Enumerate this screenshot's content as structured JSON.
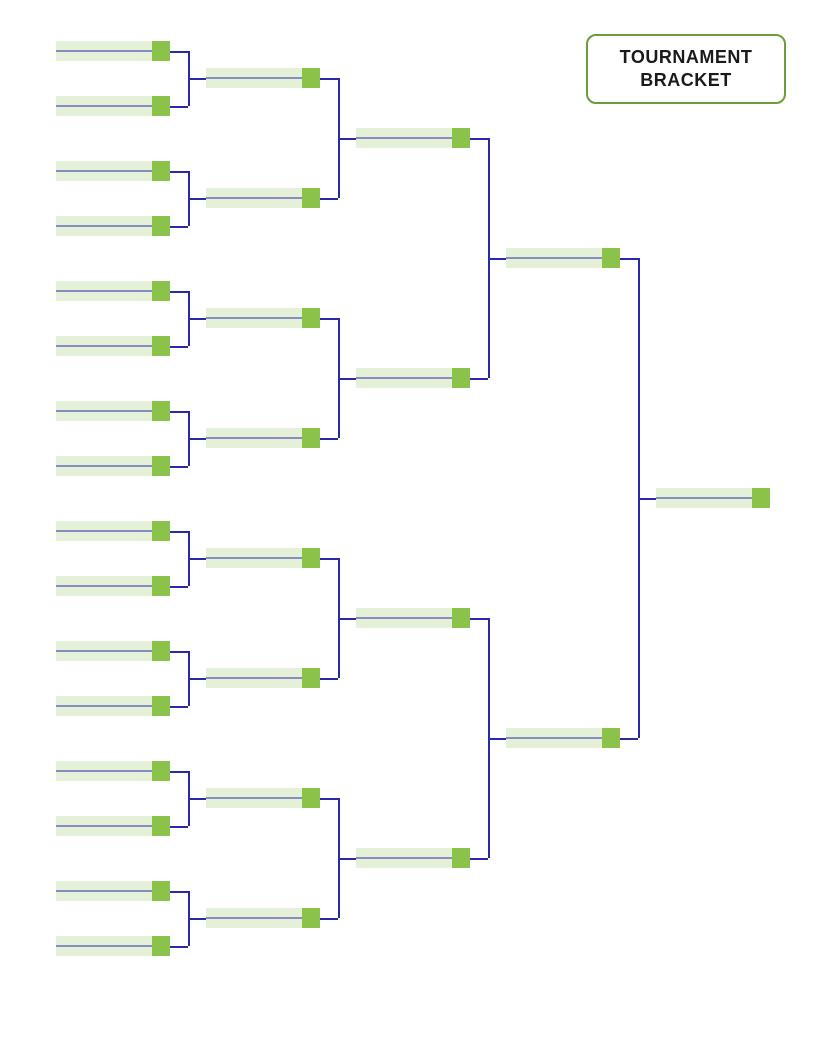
{
  "title": "TOURNAMENT BRACKET",
  "colors": {
    "border": "#6d9c3a",
    "slot_bg": "#e5f0d9",
    "slot_accent": "#8bc34a",
    "line": "#2a2aa8"
  },
  "bracket": {
    "round1": [
      {
        "name": "",
        "score": ""
      },
      {
        "name": "",
        "score": ""
      },
      {
        "name": "",
        "score": ""
      },
      {
        "name": "",
        "score": ""
      },
      {
        "name": "",
        "score": ""
      },
      {
        "name": "",
        "score": ""
      },
      {
        "name": "",
        "score": ""
      },
      {
        "name": "",
        "score": ""
      },
      {
        "name": "",
        "score": ""
      },
      {
        "name": "",
        "score": ""
      },
      {
        "name": "",
        "score": ""
      },
      {
        "name": "",
        "score": ""
      },
      {
        "name": "",
        "score": ""
      },
      {
        "name": "",
        "score": ""
      },
      {
        "name": "",
        "score": ""
      },
      {
        "name": "",
        "score": ""
      }
    ],
    "round2": [
      {
        "name": "",
        "score": ""
      },
      {
        "name": "",
        "score": ""
      },
      {
        "name": "",
        "score": ""
      },
      {
        "name": "",
        "score": ""
      },
      {
        "name": "",
        "score": ""
      },
      {
        "name": "",
        "score": ""
      },
      {
        "name": "",
        "score": ""
      },
      {
        "name": "",
        "score": ""
      }
    ],
    "round3": [
      {
        "name": "",
        "score": ""
      },
      {
        "name": "",
        "score": ""
      },
      {
        "name": "",
        "score": ""
      },
      {
        "name": "",
        "score": ""
      }
    ],
    "round4": [
      {
        "name": "",
        "score": ""
      },
      {
        "name": "",
        "score": ""
      }
    ],
    "winner": {
      "name": "",
      "score": ""
    }
  }
}
